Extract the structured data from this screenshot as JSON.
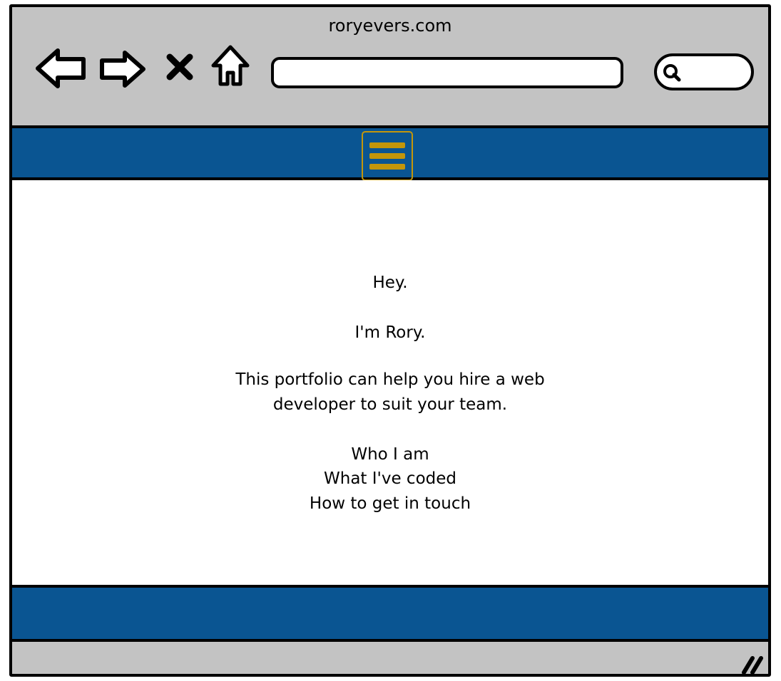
{
  "browser": {
    "title": "roryevers.com",
    "address_value": "",
    "search_value": "",
    "icons": [
      "back-arrow-icon",
      "forward-arrow-icon",
      "stop-icon",
      "home-icon",
      "search-icon",
      "resize-grip-icon"
    ]
  },
  "navbar": {
    "menu_icon": "hamburger-menu-icon",
    "color": "#0a5592",
    "accent": "#c3960a"
  },
  "content": {
    "greeting": "Hey.",
    "intro": "I'm Rory.",
    "description_line1": "This portfolio can help you hire a web",
    "description_line2": "developer to suit your team.",
    "links": [
      "Who I am",
      "What I've coded",
      "How to get in touch"
    ]
  },
  "footer": {
    "color": "#0a5592"
  }
}
